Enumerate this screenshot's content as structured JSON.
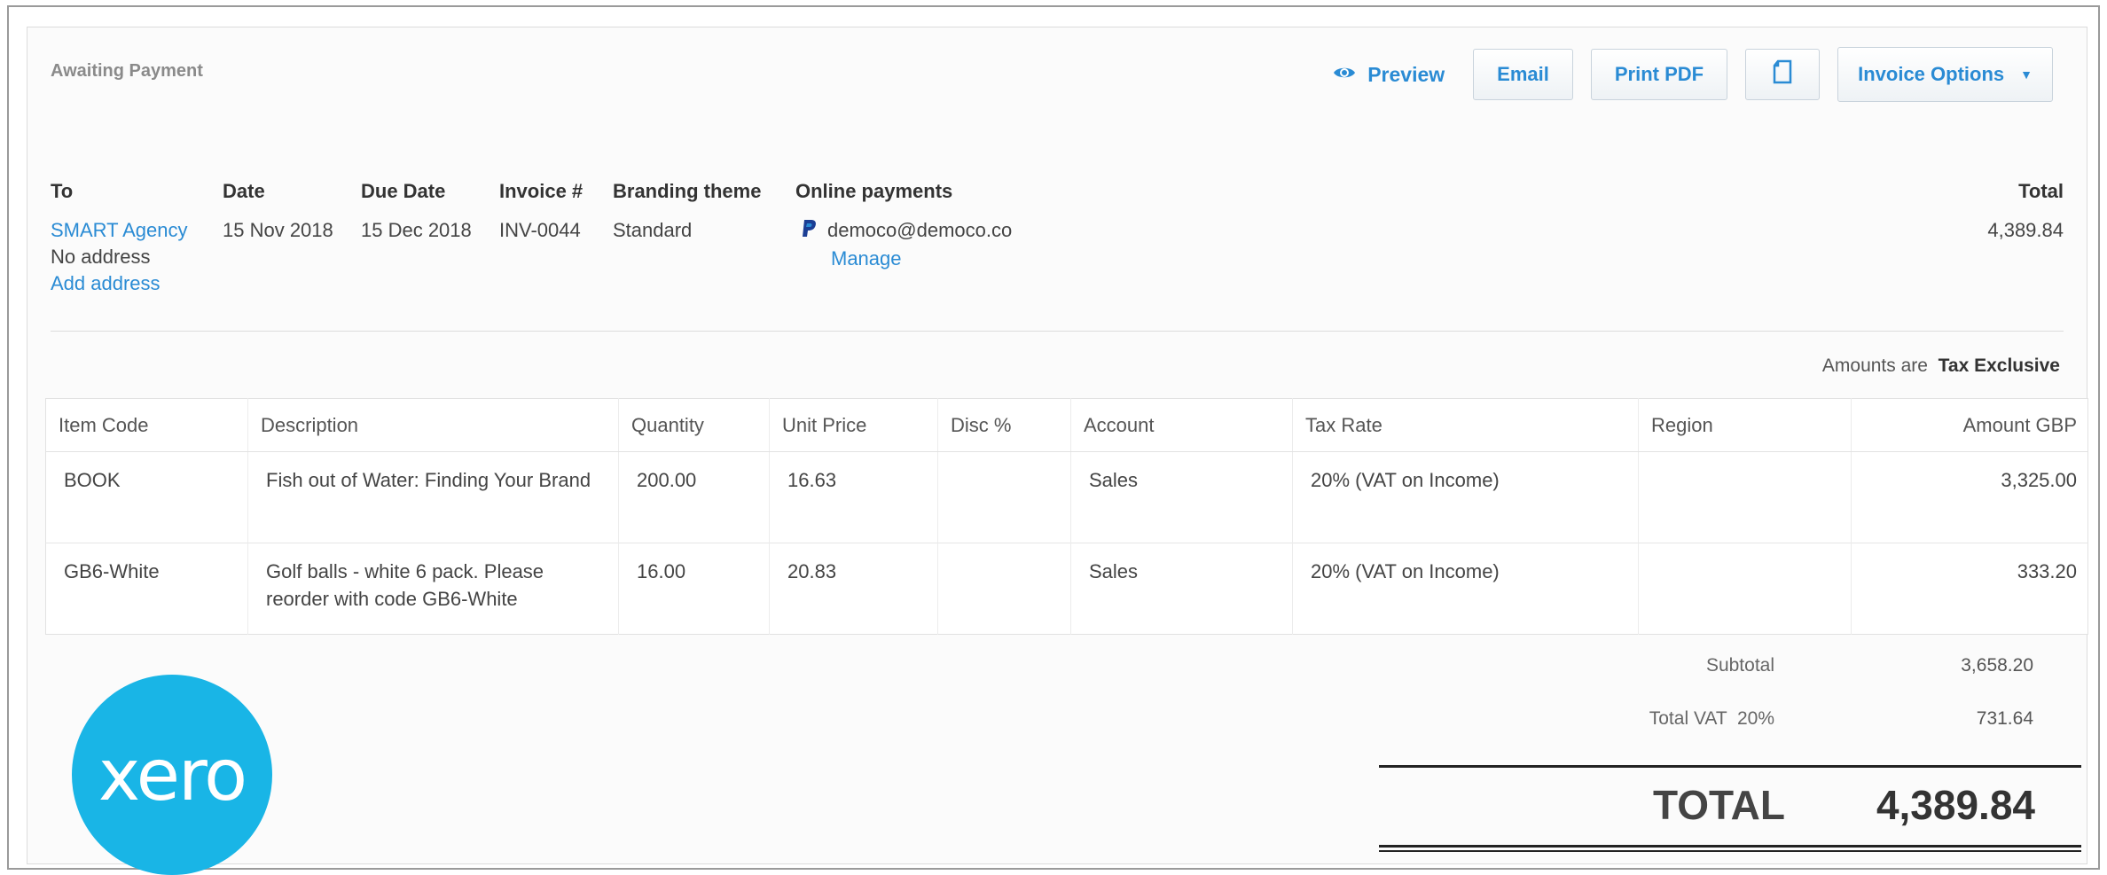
{
  "status": "Awaiting Payment",
  "actions": {
    "preview": "Preview",
    "email": "Email",
    "print_pdf": "Print PDF",
    "invoice_options": "Invoice Options"
  },
  "details": {
    "to_label": "To",
    "to_name": "SMART Agency",
    "to_address": "No address",
    "add_address": "Add address",
    "date_label": "Date",
    "date": "15 Nov 2018",
    "due_label": "Due Date",
    "due": "15 Dec 2018",
    "invoice_label": "Invoice #",
    "invoice": "INV-0044",
    "branding_label": "Branding theme",
    "branding": "Standard",
    "online_label": "Online payments",
    "paypal_email": "democo@democo.co",
    "manage": "Manage",
    "total_label": "Total",
    "total": "4,389.84"
  },
  "tax_note": {
    "prefix": "Amounts are",
    "mode": "Tax Exclusive"
  },
  "table": {
    "headers": [
      "Item Code",
      "Description",
      "Quantity",
      "Unit Price",
      "Disc %",
      "Account",
      "Tax Rate",
      "Region",
      "Amount GBP"
    ],
    "rows": [
      [
        "BOOK",
        "Fish out of Water: Finding Your Brand",
        "200.00",
        "16.63",
        "",
        "Sales",
        "20% (VAT on Income)",
        "",
        "3,325.00"
      ],
      [
        "GB6-White",
        "Golf balls - white 6 pack. Please reorder with code GB6-White",
        "16.00",
        "20.83",
        "",
        "Sales",
        "20% (VAT on Income)",
        "",
        "333.20"
      ]
    ]
  },
  "totals": {
    "subtotal_label": "Subtotal",
    "subtotal": "3,658.20",
    "vat_label": "Total VAT  20%",
    "vat": "731.64",
    "total_label": "TOTAL",
    "total": "4,389.84"
  },
  "logo": {
    "text": "xero",
    "color": "#19b5e6"
  },
  "colors": {
    "link": "#2a8bd4",
    "border": "#dcdcdc"
  },
  "icons": {
    "preview": "eye-icon",
    "copy": "copy-icon",
    "paypal": "paypal-icon",
    "options": "chevron-down-icon"
  }
}
